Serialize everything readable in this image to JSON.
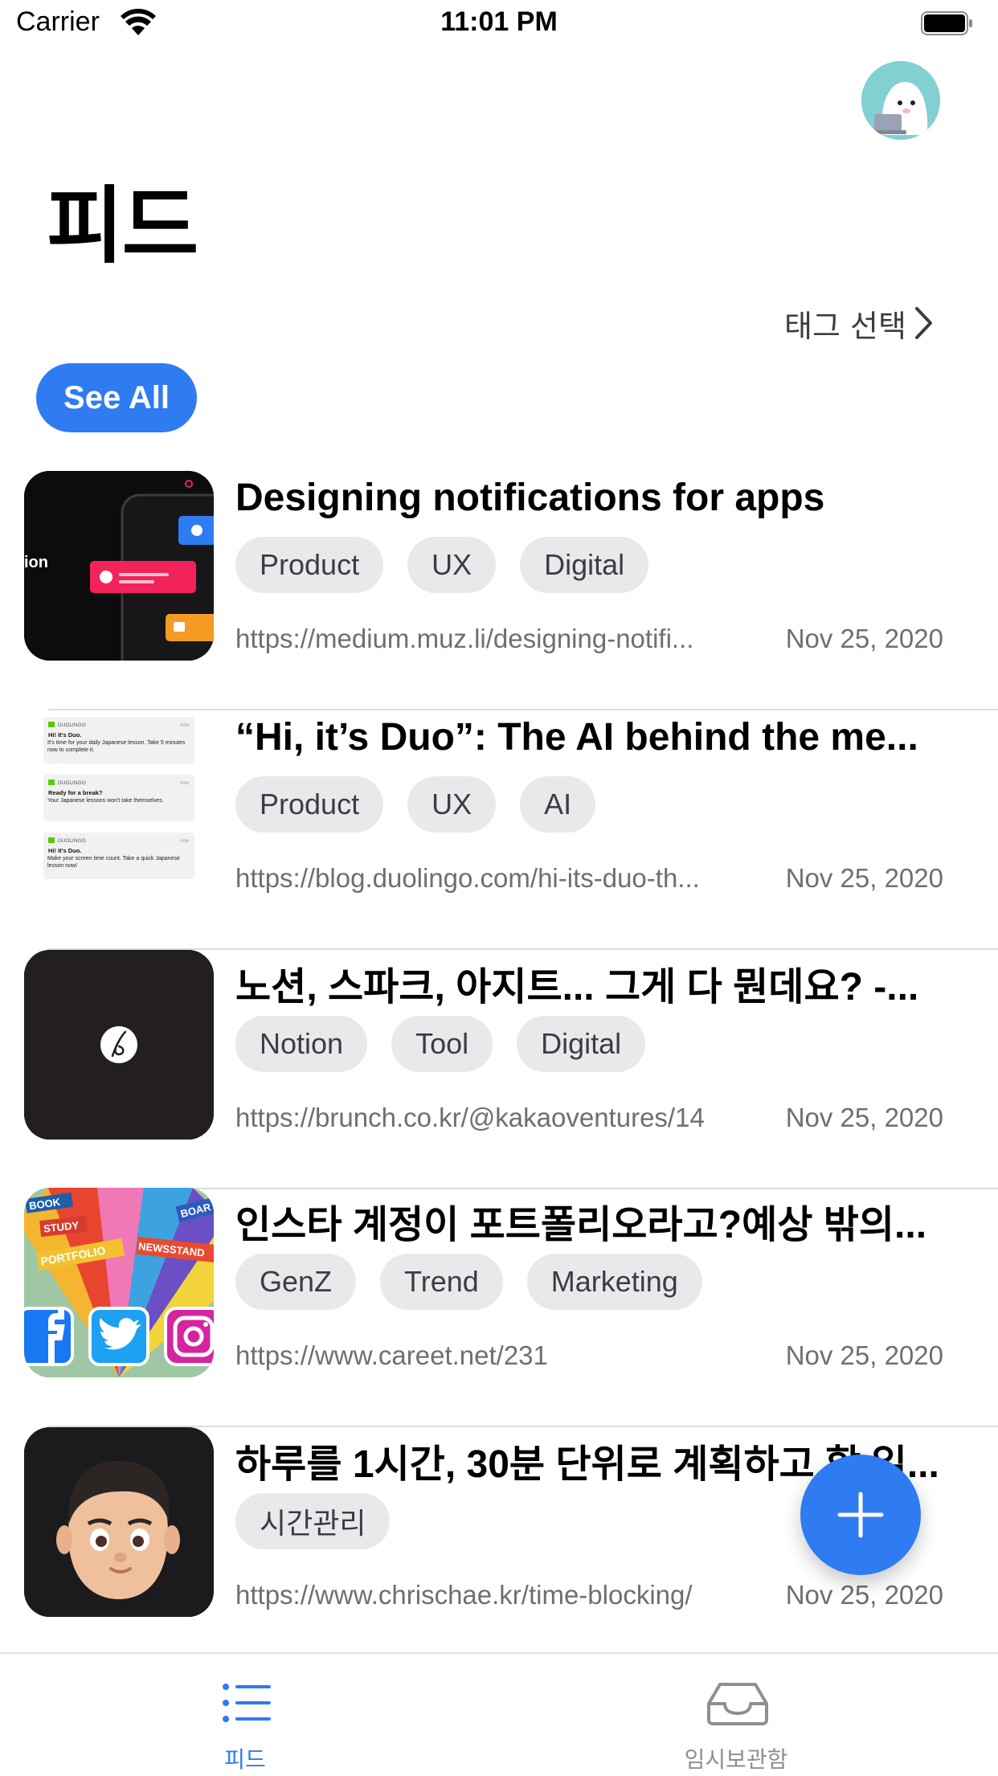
{
  "status_bar": {
    "carrier": "Carrier",
    "time": "11:01 PM"
  },
  "header": {
    "title": "피드",
    "tag_select_label": "태그 선택",
    "see_all_label": "See All"
  },
  "colors": {
    "accent": "#2f7bf2",
    "tag_bg": "#e9e9ec",
    "secondary_text": "#6e6e73",
    "tab_inactive": "#8e8e93"
  },
  "feed": [
    {
      "title": "Designing notifications for apps",
      "tags": [
        "Product",
        "UX",
        "Digital"
      ],
      "url": "https://medium.muz.li/designing-notifi...",
      "date": "Nov 25, 2020",
      "thumb_text": "ion"
    },
    {
      "title": "“Hi, it’s Duo”: The AI behind the me...",
      "tags": [
        "Product",
        "UX",
        "AI"
      ],
      "url": "https://blog.duolingo.com/hi-its-duo-th...",
      "date": "Nov 25, 2020"
    },
    {
      "title": "노션, 스파크, 아지트... 그게 다 뭔데요? -...",
      "tags": [
        "Notion",
        "Tool",
        "Digital"
      ],
      "url": "https://brunch.co.kr/@kakaoventures/14",
      "date": "Nov 25, 2020"
    },
    {
      "title": "인스타 계정이 포트폴리오라고?예상 밖의...",
      "tags": [
        "GenZ",
        "Trend",
        "Marketing"
      ],
      "url": "https://www.careet.net/231",
      "date": "Nov 25, 2020",
      "thumb_words": [
        "BOOK",
        "STUDY",
        "PORTFOLIO",
        "NEWSSTAND",
        "BOAR"
      ]
    },
    {
      "title": "하루를 1시간, 30분 단위로 계획하고 할 일...",
      "tags": [
        "시간관리"
      ],
      "url": "https://www.chrischae.kr/time-blocking/",
      "date": "Nov 25, 2020"
    }
  ],
  "duolingo_thumb": {
    "brand": "DUOLINGO",
    "cards": [
      {
        "title": "Hi! It's Duo.",
        "body": "It's time for your daily Japanese lesson. Take 5 minutes now to complete it."
      },
      {
        "title": "Ready for a break?",
        "body": "Your Japanese lessons won't take themselves."
      },
      {
        "title": "Hi! It's Duo.",
        "body": "Make your screen time count. Take a quick Japanese lesson now!"
      }
    ],
    "time_label": "now"
  },
  "tab_bar": {
    "tabs": [
      {
        "label": "피드",
        "icon": "list-icon",
        "active": true
      },
      {
        "label": "임시보관함",
        "icon": "tray-icon",
        "active": false
      }
    ]
  }
}
